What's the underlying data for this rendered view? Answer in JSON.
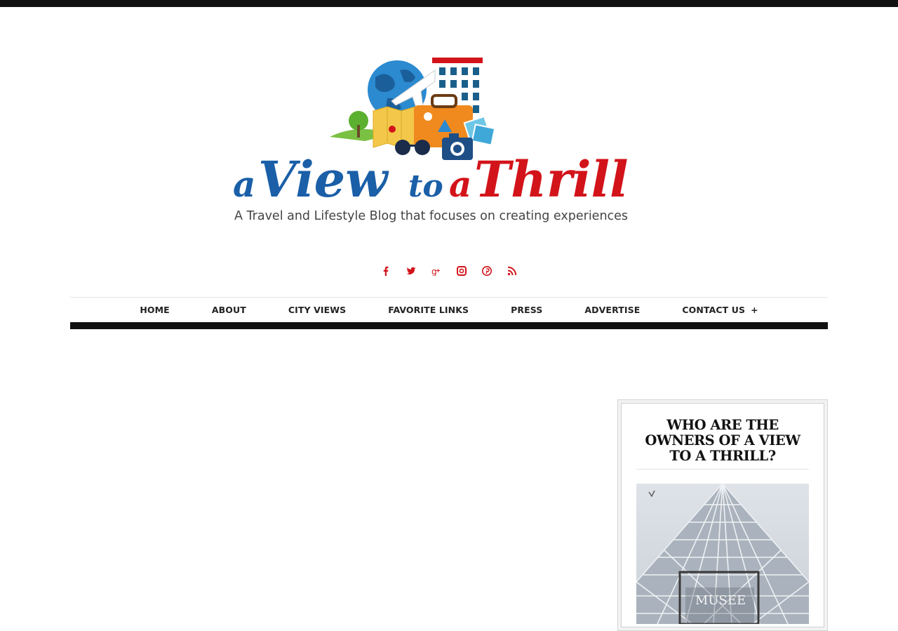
{
  "header": {
    "logo": {
      "title_a1": "a",
      "title_view": "View",
      "title_to": "to",
      "title_a2": "a",
      "title_thrill": "Thrill",
      "tagline": "A Travel and Lifestyle Blog that focuses on creating experiences"
    }
  },
  "social": {
    "icons": [
      "facebook-icon",
      "twitter-icon",
      "google-plus-icon",
      "instagram-icon",
      "pinterest-icon",
      "rss-icon"
    ]
  },
  "nav": {
    "items": [
      "HOME",
      "ABOUT",
      "CITY VIEWS",
      "FAVORITE LINKS",
      "PRESS",
      "ADVERTISE",
      "CONTACT US"
    ],
    "contact_plus": "+"
  },
  "sidebar": {
    "widget_title": "WHO ARE THE OWNERS OF A VIEW TO A THRILL?",
    "photo_sign": "MUSEE"
  },
  "colors": {
    "blue": "#1a5fa8",
    "red": "#d3131a",
    "dark": "#111111"
  }
}
